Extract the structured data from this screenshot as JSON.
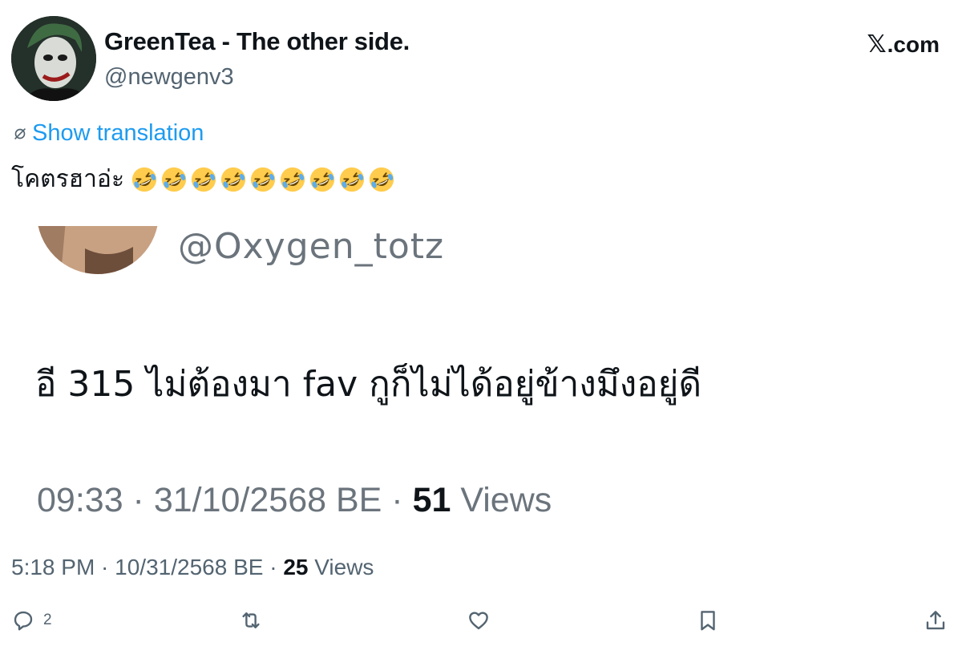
{
  "header": {
    "display_name": "GreenTea - The other side.",
    "handle": "@newgenv3",
    "brand": ".com",
    "brand_x": "𝕏"
  },
  "translation": {
    "label": "Show translation"
  },
  "tweet": {
    "text": "โคตรฮาอ่ะ",
    "emoji_count": 9,
    "emoji_name": "rolling-on-the-floor-laughing"
  },
  "embedded": {
    "handle": "@Oxygen_totz",
    "text": "อี 315 ไม่ต้องมา fav กูก็ไม่ได้อยู่ข้างมึงอยู่ดี",
    "time": "09:33 · 31/10/2568 BE · ",
    "views_count": "51",
    "views_label": " Views"
  },
  "meta": {
    "time": "5:18 PM · 10/31/2568 BE · ",
    "views_count": "25",
    "views_label": " Views"
  },
  "actions": {
    "reply_count": "2",
    "icons": [
      "reply-icon",
      "retweet-icon",
      "like-icon",
      "bookmark-icon",
      "share-icon"
    ]
  },
  "colors": {
    "link": "#1d9bf0",
    "secondary": "#536471",
    "primary": "#0f1419"
  }
}
